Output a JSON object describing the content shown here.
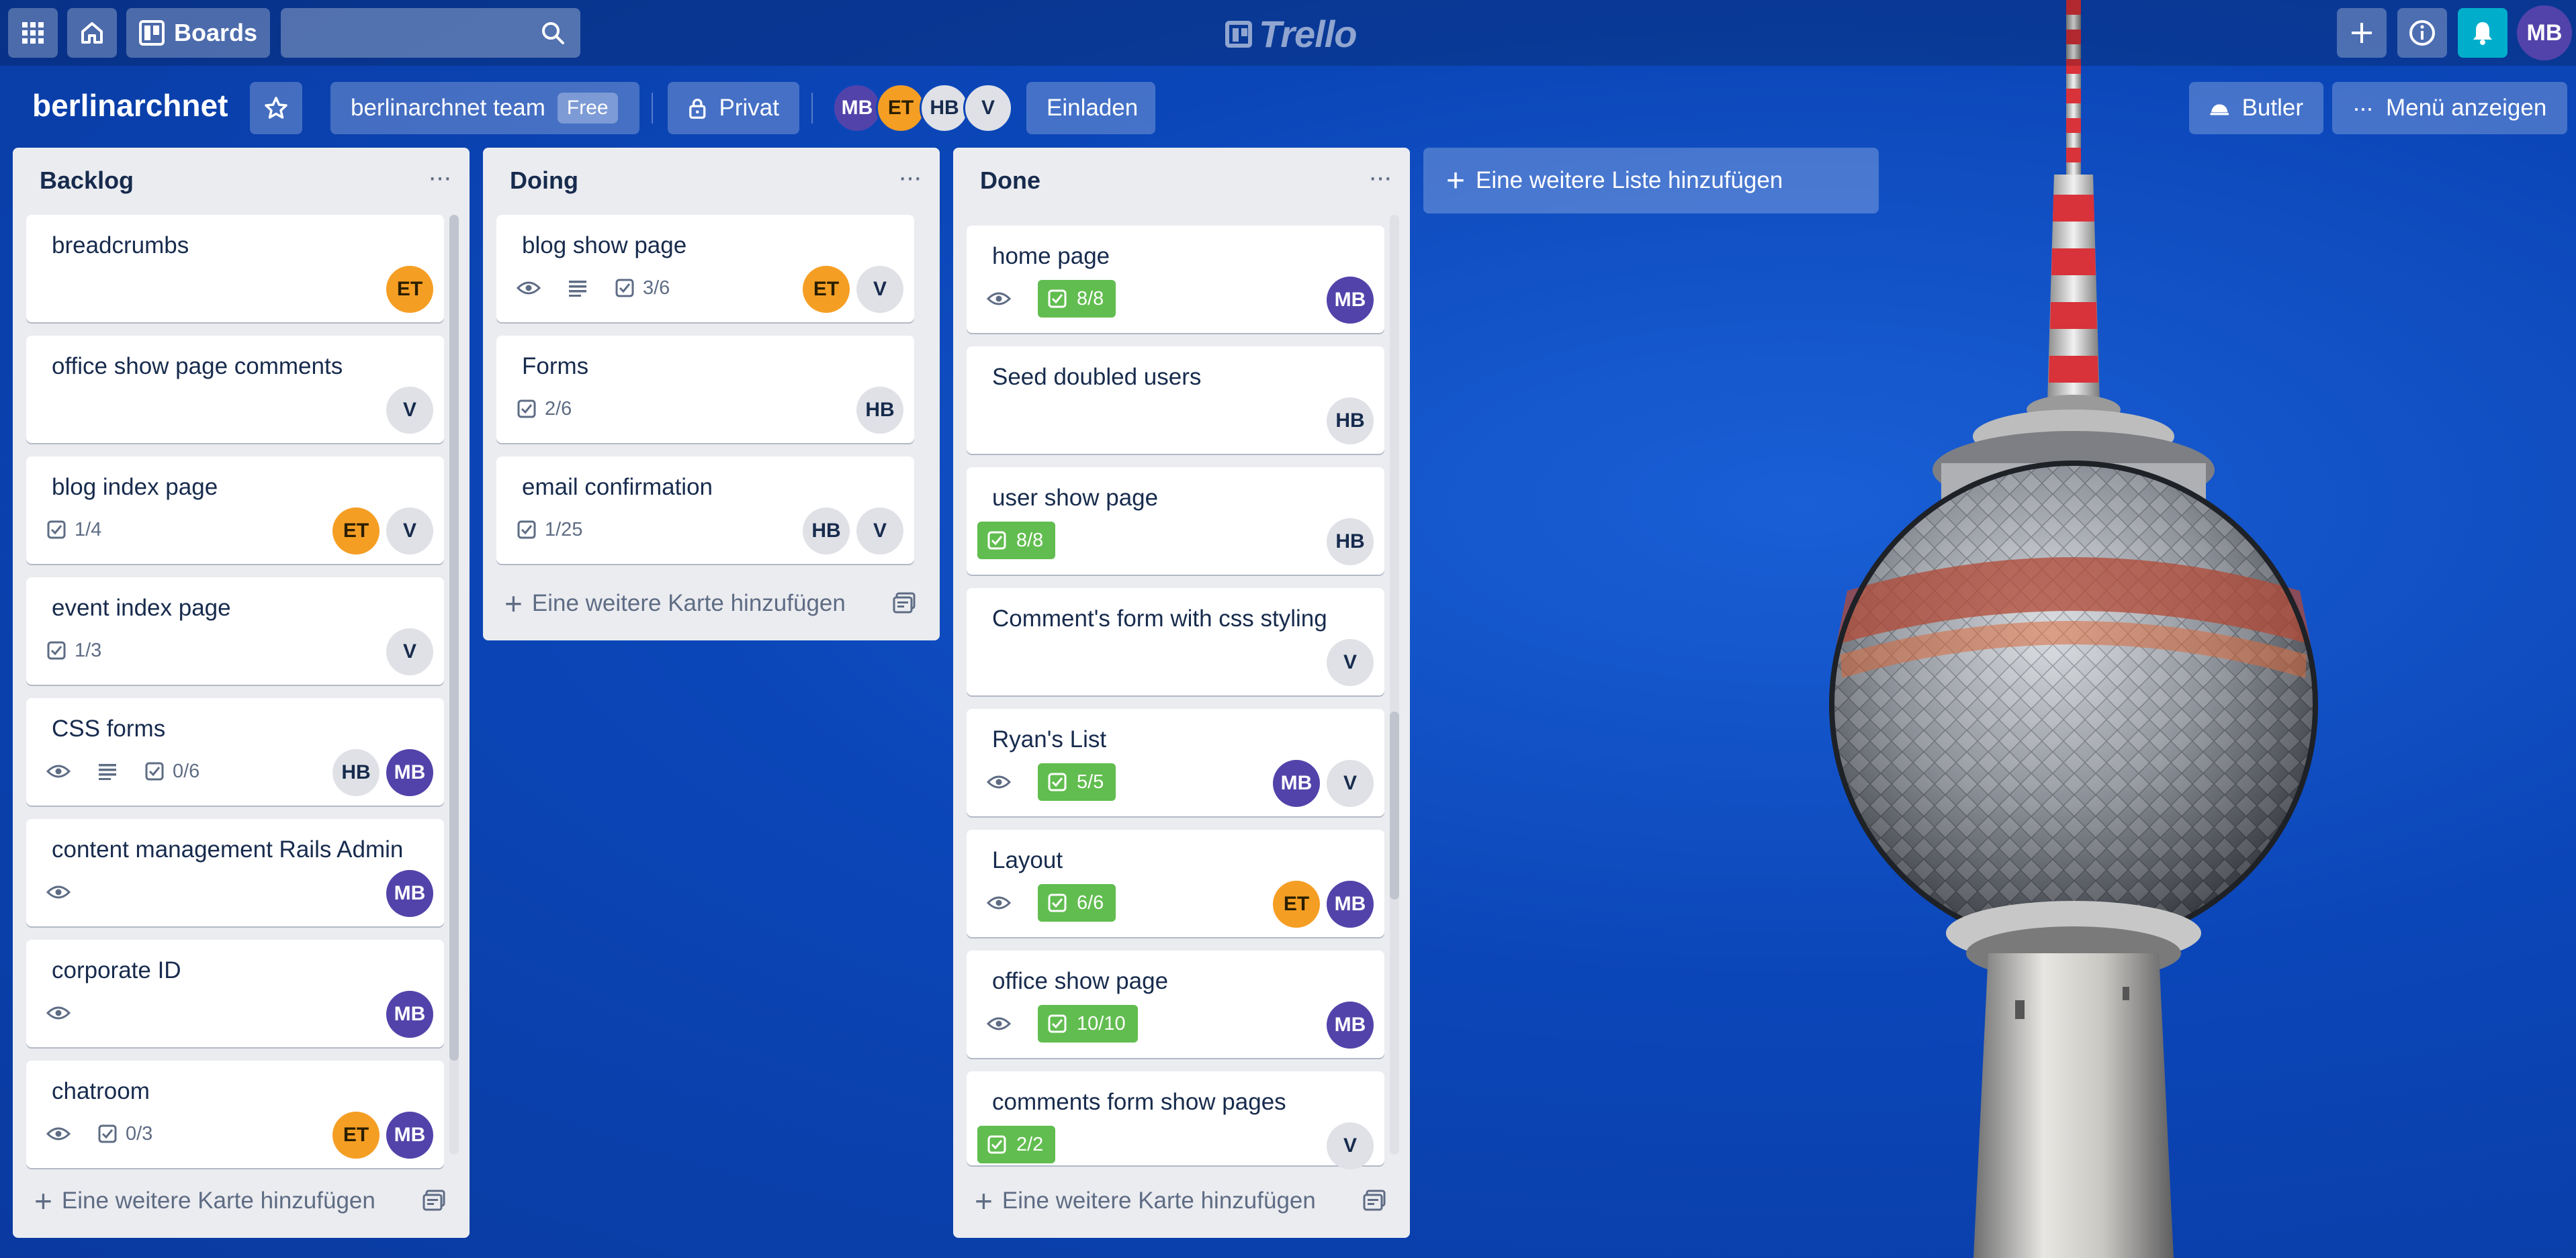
{
  "topbar": {
    "boards_label": "Boards",
    "search_placeholder": "",
    "logo_text": "Trello",
    "user_initials": "MB"
  },
  "board": {
    "title": "berlinarchnet",
    "team_label": "berlinarchnet team",
    "team_badge": "Free",
    "visibility_label": "Privat",
    "invite_label": "Einladen",
    "butler_label": "Butler",
    "menu_label": "Menü anzeigen",
    "members": [
      "MB",
      "ET",
      "HB",
      "V"
    ]
  },
  "lists": [
    {
      "title": "Backlog",
      "add_card_label": "Eine weitere Karte hinzufügen",
      "cards": [
        {
          "title": "breadcrumbs",
          "members": [
            "ET"
          ]
        },
        {
          "title": "office show page comments",
          "members": [
            "V"
          ]
        },
        {
          "title": "blog index page",
          "checklist": "1/4",
          "members": [
            "ET",
            "V"
          ]
        },
        {
          "title": "event index page",
          "checklist": "1/3",
          "members": [
            "V"
          ]
        },
        {
          "title": "CSS forms",
          "watch": true,
          "description": true,
          "checklist": "0/6",
          "members": [
            "HB",
            "MB"
          ]
        },
        {
          "title": "content management Rails Admin",
          "watch": true,
          "members": [
            "MB"
          ]
        },
        {
          "title": "corporate ID",
          "watch": true,
          "members": [
            "MB"
          ]
        },
        {
          "title": "chatroom",
          "watch": true,
          "checklist": "0/3",
          "members": [
            "ET",
            "MB"
          ]
        }
      ]
    },
    {
      "title": "Doing",
      "add_card_label": "Eine weitere Karte hinzufügen",
      "cards": [
        {
          "title": "blog show page",
          "watch": true,
          "description": true,
          "checklist": "3/6",
          "members": [
            "ET",
            "V"
          ]
        },
        {
          "title": "Forms",
          "checklist": "2/6",
          "members": [
            "HB"
          ]
        },
        {
          "title": "email confirmation",
          "checklist": "1/25",
          "members": [
            "HB",
            "V"
          ]
        }
      ]
    },
    {
      "title": "Done",
      "add_card_label": "Eine weitere Karte hinzufügen",
      "cards": [
        {
          "title": "home page",
          "watch": true,
          "checklist_done": "8/8",
          "members": [
            "MB"
          ]
        },
        {
          "title": "Seed doubled users",
          "members": [
            "HB"
          ]
        },
        {
          "title": "user show page",
          "checklist_done": "8/8",
          "members": [
            "HB"
          ]
        },
        {
          "title": "Comment's form with css styling",
          "members": [
            "V"
          ]
        },
        {
          "title": "Ryan's List",
          "watch": true,
          "checklist_done": "5/5",
          "members": [
            "MB",
            "V"
          ]
        },
        {
          "title": "Layout",
          "watch": true,
          "checklist_done": "6/6",
          "members": [
            "ET",
            "MB"
          ]
        },
        {
          "title": "office show page",
          "watch": true,
          "checklist_done": "10/10",
          "members": [
            "MB"
          ]
        },
        {
          "title": "comments form show pages",
          "checklist_done": "2/2",
          "members": [
            "V"
          ]
        }
      ]
    }
  ],
  "add_list_label": "Eine weitere Liste hinzufügen"
}
